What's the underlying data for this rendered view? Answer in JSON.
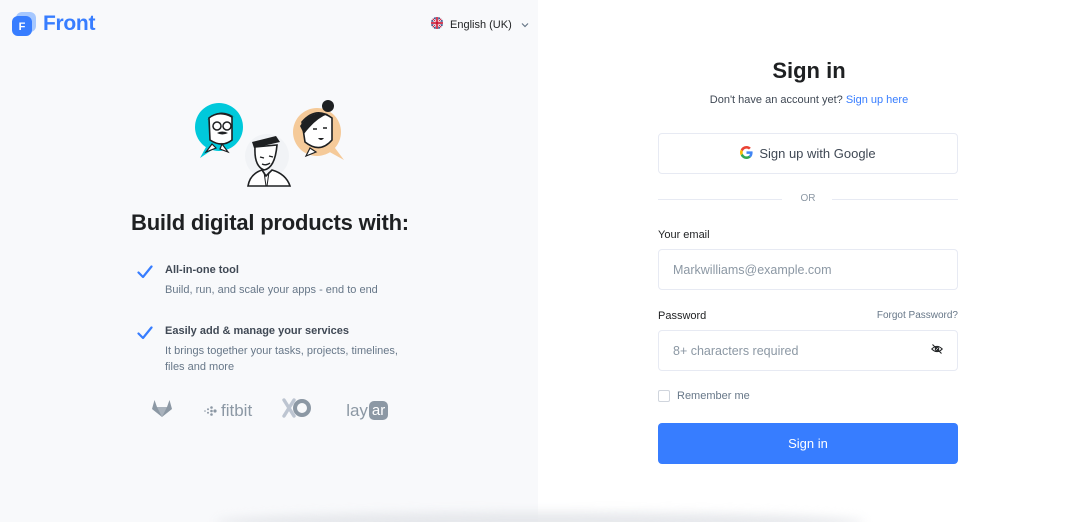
{
  "brand": {
    "logo_letter": "F",
    "name": "Front",
    "color": "#377dff"
  },
  "language": {
    "label": "English (UK)",
    "flag": "uk-flag-icon"
  },
  "left": {
    "headline": "Build digital products with:",
    "features": [
      {
        "title": "All-in-one tool",
        "description": "Build, run, and scale your apps - end to end"
      },
      {
        "title": "Easily add & manage your services",
        "description": "It brings together your tasks, projects, timelines, files and more"
      }
    ],
    "brands": [
      "gitlab-logo",
      "fitbit",
      "xo-logo",
      "layar"
    ],
    "brand_text": {
      "fitbit": "fitbit",
      "layar_a": "lay",
      "layar_b": "ar"
    }
  },
  "signin": {
    "title": "Sign in",
    "no_account": "Don't have an account yet?",
    "signup_link": "Sign up here",
    "google_button": "Sign up with Google",
    "or": "OR",
    "email_label": "Your email",
    "email_placeholder": "Markwilliams@example.com",
    "password_label": "Password",
    "forgot_password": "Forgot Password?",
    "password_placeholder": "8+ characters required",
    "remember_me": "Remember me",
    "submit": "Sign in"
  }
}
